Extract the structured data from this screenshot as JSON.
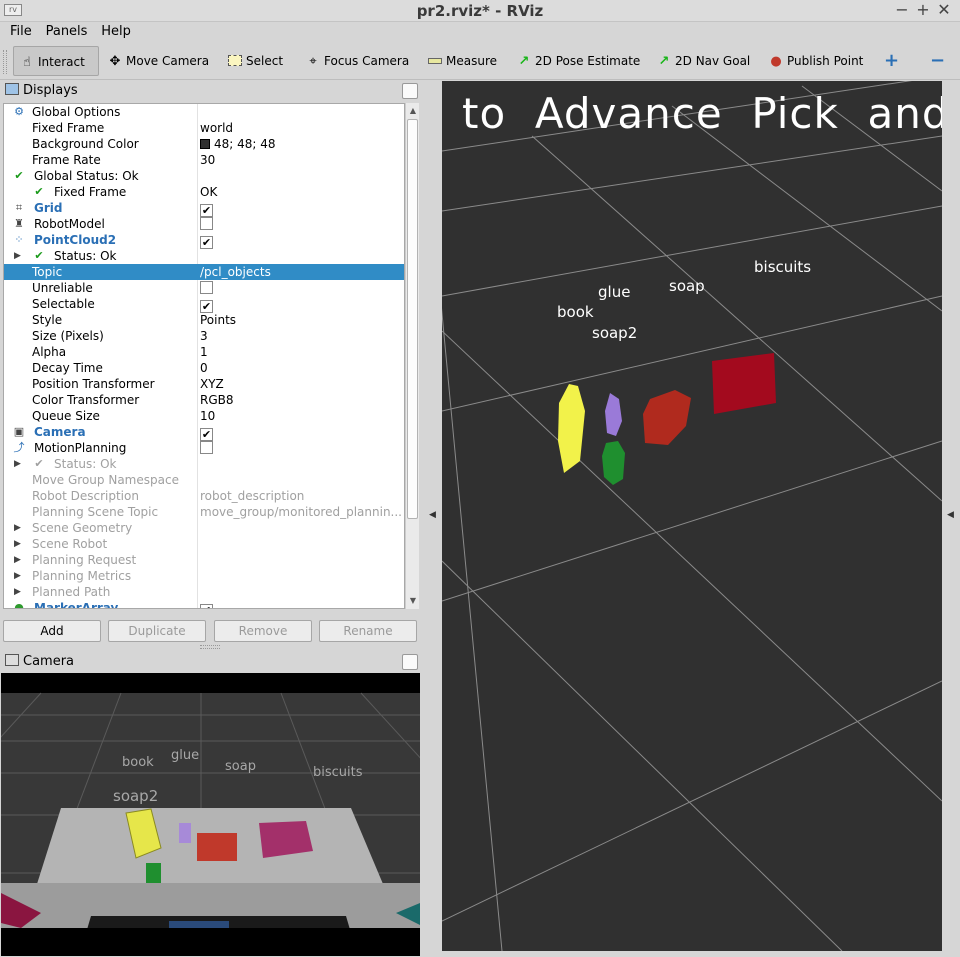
{
  "window": {
    "title": "pr2.rviz* - RViz",
    "icon": "rviz-app-icon"
  },
  "menu": {
    "items": [
      "File",
      "Panels",
      "Help"
    ]
  },
  "toolbar": {
    "tools": [
      {
        "label": "Interact",
        "icon": "hand-icon"
      },
      {
        "label": "Move Camera",
        "icon": "move-camera-icon"
      },
      {
        "label": "Select",
        "icon": "select-icon"
      },
      {
        "label": "Focus Camera",
        "icon": "focus-camera-icon"
      },
      {
        "label": "Measure",
        "icon": "ruler-icon"
      },
      {
        "label": "2D Pose Estimate",
        "icon": "green-arrow-icon"
      },
      {
        "label": "2D Nav Goal",
        "icon": "green-arrow-icon"
      },
      {
        "label": "Publish Point",
        "icon": "map-pin-icon"
      }
    ],
    "add_icon": "+",
    "remove_icon": "−"
  },
  "displays": {
    "title": "Displays",
    "rows": [
      {
        "name": "Global Options",
        "value": ""
      },
      {
        "name": "Fixed Frame",
        "value": "world"
      },
      {
        "name": "Background Color",
        "value": "48; 48; 48"
      },
      {
        "name": "Frame Rate",
        "value": "30"
      },
      {
        "name": "Global Status: Ok",
        "value": ""
      },
      {
        "name": "Fixed Frame",
        "value": "OK"
      },
      {
        "name": "Grid",
        "value": "✔"
      },
      {
        "name": "RobotModel",
        "value": ""
      },
      {
        "name": "PointCloud2",
        "value": "✔"
      },
      {
        "name": "Status: Ok",
        "value": ""
      },
      {
        "name": "Topic",
        "value": "/pcl_objects"
      },
      {
        "name": "Unreliable",
        "value": ""
      },
      {
        "name": "Selectable",
        "value": "✔"
      },
      {
        "name": "Style",
        "value": "Points"
      },
      {
        "name": "Size (Pixels)",
        "value": "3"
      },
      {
        "name": "Alpha",
        "value": "1"
      },
      {
        "name": "Decay Time",
        "value": "0"
      },
      {
        "name": "Position Transformer",
        "value": "XYZ"
      },
      {
        "name": "Color Transformer",
        "value": "RGB8"
      },
      {
        "name": "Queue Size",
        "value": "10"
      },
      {
        "name": "Camera",
        "value": "✔"
      },
      {
        "name": "MotionPlanning",
        "value": ""
      },
      {
        "name": "Status: Ok",
        "value": ""
      },
      {
        "name": "Move Group Namespace",
        "value": ""
      },
      {
        "name": "Robot Description",
        "value": "robot_description"
      },
      {
        "name": "Planning Scene Topic",
        "value": "move_group/monitored_plannin..."
      },
      {
        "name": "Scene Geometry",
        "value": ""
      },
      {
        "name": "Scene Robot",
        "value": ""
      },
      {
        "name": "Planning Request",
        "value": ""
      },
      {
        "name": "Planning Metrics",
        "value": ""
      },
      {
        "name": "Planned Path",
        "value": ""
      },
      {
        "name": "MarkerArray",
        "value": "✔"
      }
    ],
    "buttons": {
      "add": "Add",
      "duplicate": "Duplicate",
      "remove": "Remove",
      "rename": "Rename"
    }
  },
  "camera_panel": {
    "title": "Camera",
    "labels": [
      "book",
      "glue",
      "soap",
      "biscuits",
      "soap2"
    ]
  },
  "viewport": {
    "banner": "to  Advance  Pick  and",
    "labels": [
      "glue",
      "soap",
      "biscuits",
      "book",
      "soap2"
    ],
    "colors": {
      "background": "#303030",
      "yellow": "#f2f24a",
      "purple": "#9a7ad8",
      "green": "#1f8f2f",
      "red": "#b02a1e",
      "crimson": "#a30a1e"
    }
  }
}
